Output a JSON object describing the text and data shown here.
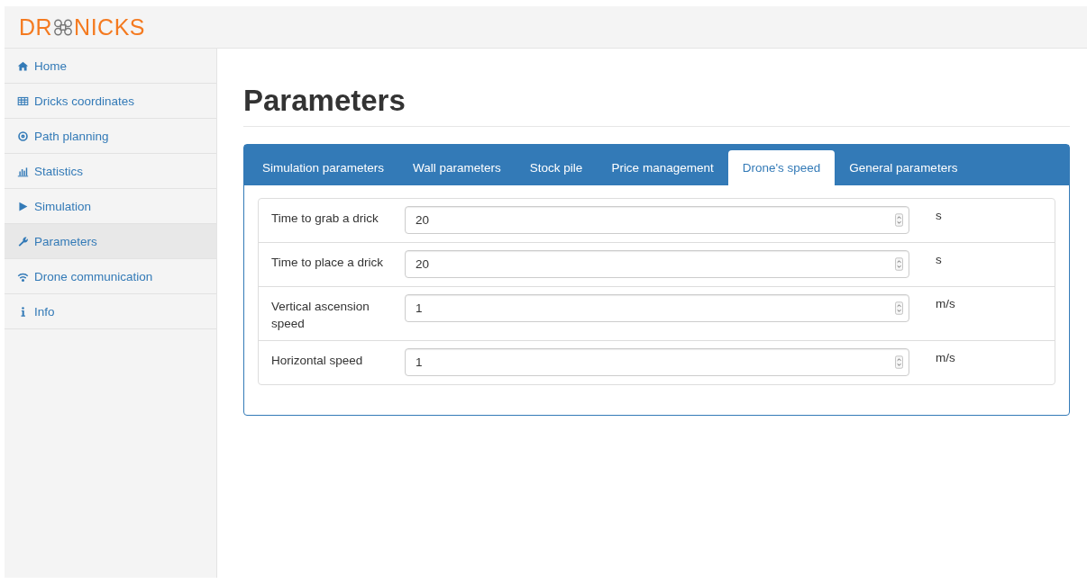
{
  "logo": {
    "before": "DR",
    "after": "NICKS"
  },
  "sidebar": {
    "items": [
      {
        "label": "Home",
        "selected": false
      },
      {
        "label": "Dricks coordinates",
        "selected": false
      },
      {
        "label": "Path planning",
        "selected": false
      },
      {
        "label": "Statistics",
        "selected": false
      },
      {
        "label": "Simulation",
        "selected": false
      },
      {
        "label": "Parameters",
        "selected": true
      },
      {
        "label": "Drone communication",
        "selected": false
      },
      {
        "label": "Info",
        "selected": false
      }
    ]
  },
  "page_title": "Parameters",
  "tabs": [
    {
      "label": "Simulation parameters",
      "selected": false
    },
    {
      "label": "Wall parameters",
      "selected": false
    },
    {
      "label": "Stock pile",
      "selected": false
    },
    {
      "label": "Price management",
      "selected": false
    },
    {
      "label": "Drone's speed",
      "selected": true
    },
    {
      "label": "General parameters",
      "selected": false
    }
  ],
  "fields": [
    {
      "label": "Time to grab a drick",
      "value": "20",
      "unit": "s"
    },
    {
      "label": "Time to place a drick",
      "value": "20",
      "unit": "s"
    },
    {
      "label": "Vertical ascension speed",
      "value": "1",
      "unit": "m/s"
    },
    {
      "label": "Horizontal speed",
      "value": "1",
      "unit": "m/s"
    }
  ]
}
